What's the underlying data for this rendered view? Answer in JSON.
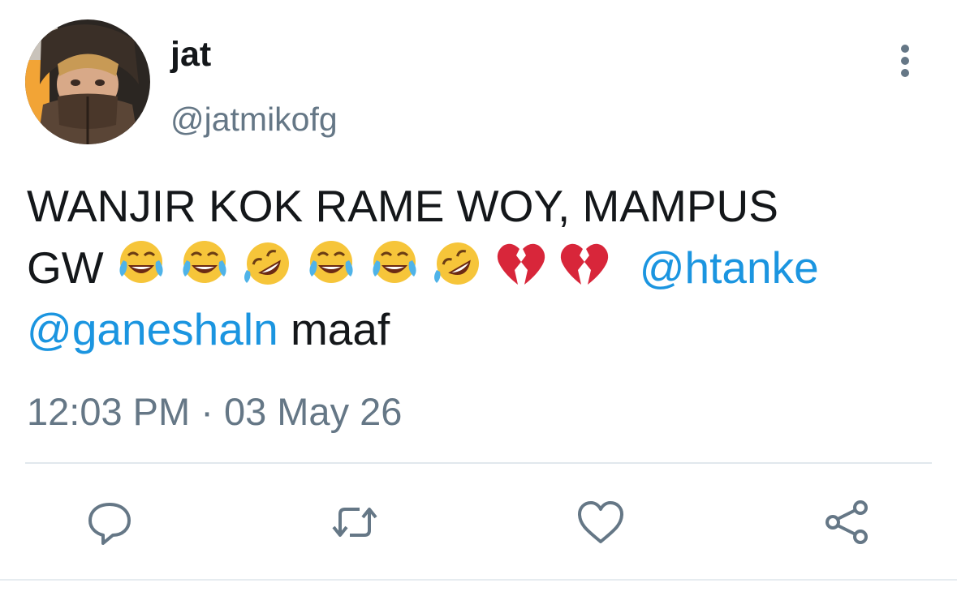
{
  "user": {
    "display_name": "jat",
    "handle": "@jatmikofg"
  },
  "tweet": {
    "text_line1": "WANJIR KOK RAME WOY, MAMPUS",
    "text_line2_start": "GW",
    "emojis": [
      "face-with-tears-of-joy",
      "face-with-tears-of-joy",
      "rolling-on-floor-laughing",
      "face-with-tears-of-joy",
      "face-with-tears-of-joy",
      "rolling-on-floor-laughing",
      "broken-heart",
      "broken-heart"
    ],
    "mention1": "@htanke",
    "mention2": "@ganeshaln",
    "text_end": "maaf"
  },
  "timestamp": "12:03 PM · 03 May 26",
  "actions": [
    "reply-icon",
    "retweet-icon",
    "like-icon",
    "share-icon"
  ],
  "colors": {
    "text": "#14171a",
    "secondary": "#657786",
    "link": "#1b95e0",
    "divider": "#e1e8ed"
  }
}
